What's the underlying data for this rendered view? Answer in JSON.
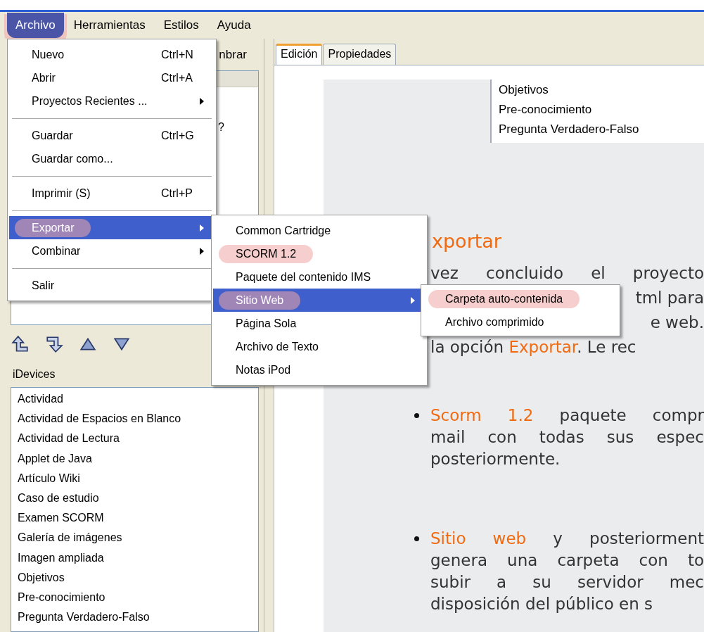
{
  "menu_bar": [
    {
      "label": "Archivo",
      "selected": true,
      "highlighted": true
    },
    {
      "label": "Herramientas",
      "selected": false,
      "highlighted": false
    },
    {
      "label": "Estilos",
      "selected": false,
      "highlighted": false
    },
    {
      "label": "Ayuda",
      "selected": false,
      "highlighted": false
    }
  ],
  "left_panel": {
    "toolbar_button": "nbrar",
    "outline_fragment": "?",
    "idevices_title": "iDevices",
    "idevices": [
      "Actividad",
      "Actividad de Espacios en Blanco",
      "Actividad de Lectura",
      "Applet de Java",
      "Artículo Wiki",
      "Caso de estudio",
      "Examen SCORM",
      "Galería de imágenes",
      "Imagen ampliada",
      "Objetivos",
      "Pre-conocimiento",
      "Pregunta Verdadero-Falso"
    ]
  },
  "editor": {
    "tabs": [
      {
        "label": "Edición",
        "selected": true
      },
      {
        "label": "Propiedades",
        "selected": false
      }
    ],
    "nav_items": [
      "Objetivos",
      "Pre-conocimiento",
      "Pregunta Verdadero-Falso"
    ],
    "heading": "xportar",
    "intro_lines": [
      {
        "clipped_start": false,
        "parts": [
          {
            "text": "vez concluido el proyecto",
            "accent": false
          }
        ]
      },
      {
        "clipped_start": true,
        "parts": [
          {
            "text": "tml para",
            "accent": false
          }
        ]
      },
      {
        "clipped_start": true,
        "parts": [
          {
            "text": "e web.",
            "accent": false
          }
        ]
      },
      {
        "clipped_start": false,
        "parts": [
          {
            "text": "la opción ",
            "accent": false
          },
          {
            "text": "Exportar",
            "accent": true
          },
          {
            "text": ". Le rec",
            "accent": false
          }
        ]
      }
    ],
    "bullets": [
      {
        "lines": [
          [
            {
              "text": "Scorm 1.2",
              "accent": true
            },
            {
              "text": " paquete compr",
              "accent": false
            }
          ],
          [
            {
              "text": "mail con todas sus espec",
              "accent": false
            }
          ],
          [
            {
              "text": "posteriormente.",
              "accent": false
            }
          ]
        ]
      },
      {
        "lines": [
          [
            {
              "text": "Sitio web",
              "accent": true
            },
            {
              "text": " y posteriorment",
              "accent": false
            }
          ],
          [
            {
              "text": "genera una carpeta con to",
              "accent": false
            }
          ],
          [
            {
              "text": "subir a su servidor mec",
              "accent": false
            }
          ],
          [
            {
              "text": "disposición del público en s",
              "accent": false
            }
          ]
        ]
      }
    ]
  },
  "file_menu": {
    "items": [
      {
        "kind": "item",
        "label": "Nuevo",
        "shortcut": "Ctrl+N",
        "submenu": false,
        "selected": false,
        "highlighted": false
      },
      {
        "kind": "item",
        "label": "Abrir",
        "shortcut": "Ctrl+A",
        "submenu": false,
        "selected": false,
        "highlighted": false
      },
      {
        "kind": "item",
        "label": "Proyectos Recientes ...",
        "submenu": true,
        "selected": false,
        "highlighted": false
      },
      {
        "kind": "separator"
      },
      {
        "kind": "item",
        "label": "Guardar",
        "shortcut": "Ctrl+G",
        "submenu": false,
        "selected": false,
        "highlighted": false
      },
      {
        "kind": "item",
        "label": "Guardar como...",
        "submenu": false,
        "selected": false,
        "highlighted": false
      },
      {
        "kind": "separator"
      },
      {
        "kind": "item",
        "label": "Imprimir (S)",
        "shortcut": "Ctrl+P",
        "submenu": false,
        "selected": false,
        "highlighted": false
      },
      {
        "kind": "separator"
      },
      {
        "kind": "item",
        "label": "Exportar",
        "submenu": true,
        "selected": true,
        "highlighted": true
      },
      {
        "kind": "item",
        "label": "Combinar",
        "submenu": true,
        "selected": false,
        "highlighted": false
      },
      {
        "kind": "separator"
      },
      {
        "kind": "item",
        "label": "Salir",
        "submenu": false,
        "selected": false,
        "highlighted": false
      }
    ]
  },
  "export_menu": {
    "items": [
      {
        "kind": "item",
        "label": "Common Cartridge",
        "submenu": false,
        "selected": false,
        "highlighted": false
      },
      {
        "kind": "item",
        "label": "SCORM 1.2",
        "submenu": false,
        "selected": false,
        "highlighted": true
      },
      {
        "kind": "item",
        "label": "Paquete del contenido IMS",
        "submenu": false,
        "selected": false,
        "highlighted": false
      },
      {
        "kind": "item",
        "label": "Sitio Web",
        "submenu": true,
        "selected": true,
        "highlighted": true
      },
      {
        "kind": "item",
        "label": "Página Sola",
        "submenu": false,
        "selected": false,
        "highlighted": false
      },
      {
        "kind": "item",
        "label": "Archivo de Texto",
        "submenu": false,
        "selected": false,
        "highlighted": false
      },
      {
        "kind": "item",
        "label": "Notas iPod",
        "submenu": false,
        "selected": false,
        "highlighted": false
      }
    ]
  },
  "web_menu": {
    "items": [
      {
        "kind": "item",
        "label": "Carpeta auto-contenida",
        "submenu": false,
        "selected": false,
        "highlighted": true
      },
      {
        "kind": "item",
        "label": "Archivo comprimido",
        "submenu": false,
        "selected": false,
        "highlighted": false
      }
    ]
  }
}
